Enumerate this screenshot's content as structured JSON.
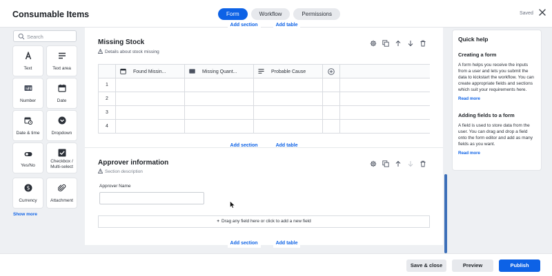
{
  "app": {
    "title": "Consumable Items",
    "saved_status": "Saved"
  },
  "tabs": [
    {
      "label": "Form",
      "active": true
    },
    {
      "label": "Workflow",
      "active": false
    },
    {
      "label": "Permissions",
      "active": false
    }
  ],
  "palette": {
    "search_placeholder": "Search",
    "items": [
      {
        "label": "Text",
        "icon": "text-icon"
      },
      {
        "label": "Text area",
        "icon": "text-area-icon"
      },
      {
        "label": "Number",
        "icon": "number-icon"
      },
      {
        "label": "Date",
        "icon": "calendar-icon"
      },
      {
        "label": "Date & time",
        "icon": "date-time-icon"
      },
      {
        "label": "Dropdown",
        "icon": "dropdown-icon"
      },
      {
        "label": "Yes/No",
        "icon": "toggle-icon"
      },
      {
        "label": "Checkbox / Multi-select",
        "icon": "checkbox-icon"
      },
      {
        "label": "Currency",
        "icon": "currency-icon"
      },
      {
        "label": "Attachment",
        "icon": "paperclip-icon"
      }
    ],
    "show_more": "Show more"
  },
  "canvas": {
    "add_section": "Add section",
    "add_table": "Add table",
    "sections": [
      {
        "title": "Missing Stock",
        "description": "Details about stock missing",
        "table": {
          "columns": [
            "Found Missin...",
            "Missing Quant...",
            "Probable Cause"
          ],
          "rows": [
            "1",
            "2",
            "3",
            "4"
          ]
        }
      },
      {
        "title": "Approver information",
        "description": "Section description",
        "field_label": "Approver Name",
        "drop_zone": "Drag any field here or click to add a new field"
      }
    ]
  },
  "help": {
    "title": "Quick help",
    "topics": [
      {
        "heading": "Creating a form",
        "body": "A form helps you receive the inputs from a user and lets you submit the data to kickstart the workflow. You can create appropriate fields and sections which suit your requirements here.",
        "link": "Read more"
      },
      {
        "heading": "Adding fields to a form",
        "body": "A field is used to store data from the user. You can drag and drop a field onto the form editor and add as many fields as you want.",
        "link": "Read more"
      }
    ]
  },
  "footer": {
    "save_close": "Save & close",
    "preview": "Preview",
    "publish": "Publish"
  },
  "colors": {
    "primary": "#0d62e6",
    "background": "#eef0f3",
    "scroll_thumb": "#3c6fb8"
  }
}
